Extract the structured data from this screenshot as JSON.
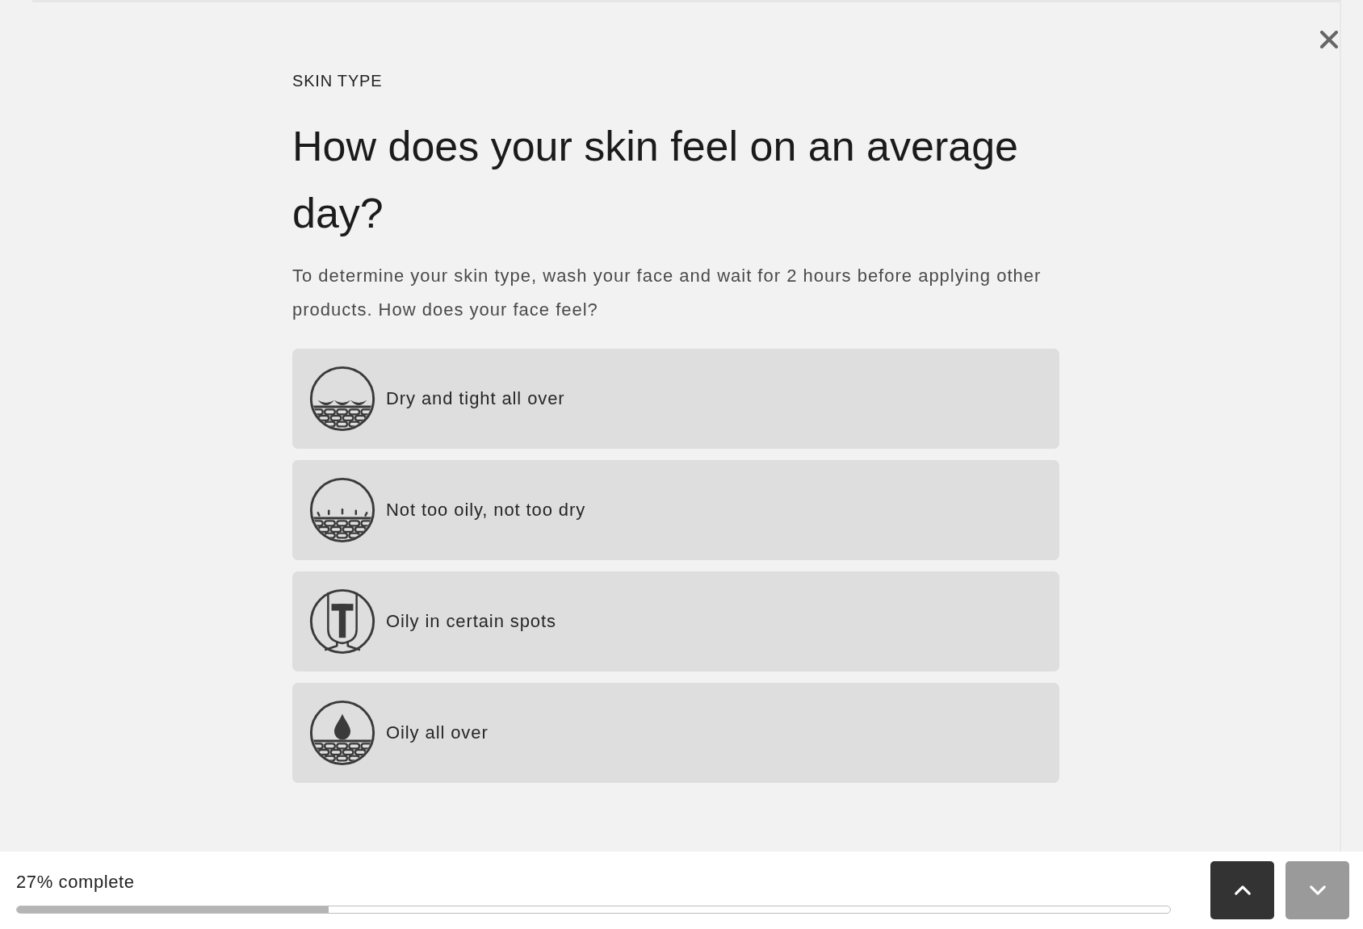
{
  "quiz": {
    "eyebrow": "SKIN TYPE",
    "question": "How does your skin feel on an average day?",
    "instructions": "To determine your skin type, wash your face and wait for 2 hours before applying other products. How does your face feel?",
    "options": [
      {
        "label": "Dry and tight all over",
        "selected": false
      },
      {
        "label": "Not too oily, not too dry",
        "selected": false
      },
      {
        "label": "Oily in certain spots",
        "selected": false
      },
      {
        "label": "Oily all over",
        "selected": false
      }
    ]
  },
  "progress": {
    "label": "27% complete",
    "level": 0.27
  },
  "nav_buttons": [
    {
      "kind": "up",
      "disabled": false
    },
    {
      "kind": "down",
      "disabled": true
    }
  ]
}
